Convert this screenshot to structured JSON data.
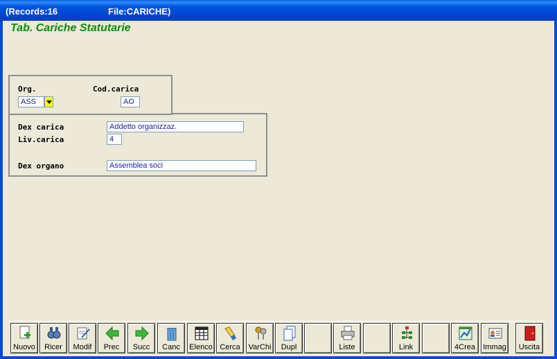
{
  "window": {
    "records": "(Records:16",
    "file": "File:CARICHE)"
  },
  "form": {
    "title": "Tab. Cariche Statutarie",
    "org_label": "Org.",
    "org_value": "ASS",
    "cod_label": "Cod.carica",
    "cod_value": "AO",
    "dex_carica_label": "Dex carica",
    "dex_carica_value": "Addetto organizzaz.",
    "liv_label": "Liv.carica",
    "liv_value": "4",
    "dex_organo_label": "Dex organo",
    "dex_organo_value": "Assemblea soci"
  },
  "toolbar": {
    "nuovo": "Nuovo",
    "ricer": "Ricer",
    "modif": "Modif",
    "prec": "Prec",
    "succ": "Succ",
    "canc": "Canc",
    "elenco": "Elenco",
    "cerca": "Cerca",
    "varchi": "VarChi",
    "dupl": "Dupl",
    "liste": "Liste",
    "link": "Link",
    "crea": "4Crea",
    "immag": "Immag",
    "uscita": "Uscita"
  },
  "colors": {
    "title_green": "#0A8A0A",
    "field_text": "#1E1E9C",
    "dropdown_yellow": "#FFFF00",
    "titlebar_blue": "#0046D5"
  }
}
